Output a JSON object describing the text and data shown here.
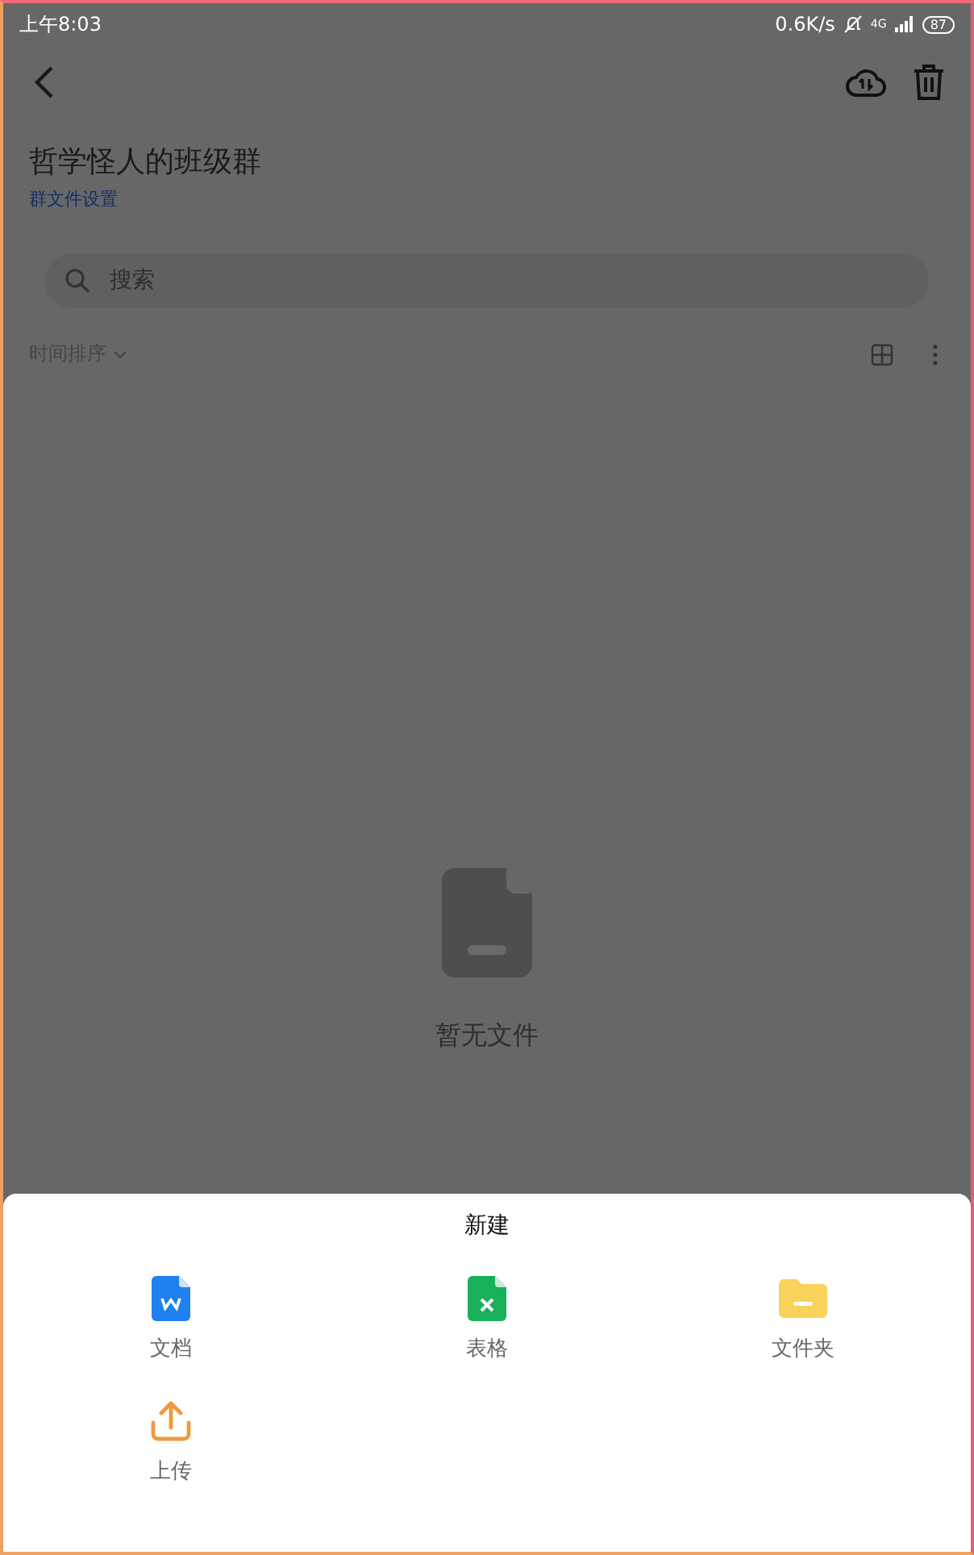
{
  "status_bar": {
    "time": "上午8:03",
    "speed": "0.6K/s",
    "network": "4G",
    "battery": "87"
  },
  "header": {
    "title": "哲学怪人的班级群",
    "link": "群文件设置"
  },
  "search": {
    "placeholder": "搜索"
  },
  "sort": {
    "label": "时间排序"
  },
  "empty": {
    "text": "暂无文件"
  },
  "sheet": {
    "title": "新建",
    "items": [
      {
        "kind": "doc",
        "label": "文档"
      },
      {
        "kind": "sheet",
        "label": "表格"
      },
      {
        "kind": "folder",
        "label": "文件夹"
      },
      {
        "kind": "upload",
        "label": "上传"
      }
    ]
  }
}
